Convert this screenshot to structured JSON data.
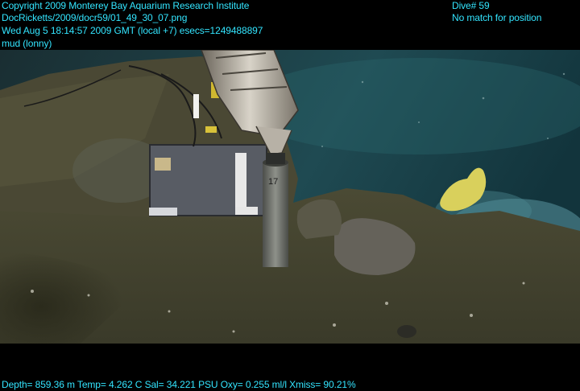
{
  "header": {
    "copyright": "Copyright 2009 Monterey Bay Aquarium Research Institute",
    "filename": "DocRicketts/2009/docr59/01_49_30_07.png",
    "timestamp": "Wed Aug  5 18:14:57 2009 GMT (local +7)  esecs=1249488897",
    "annotation": "mud (lonny)",
    "dive": "Dive# 59",
    "position_status": "No match for position"
  },
  "footer": {
    "telemetry": "Depth= 859.36 m  Temp= 4.262 C  Sal= 34.221 PSU  Oxy= 0.255 ml/l  Xmiss= 90.21%"
  },
  "scene": {
    "core_tube_label": "17"
  },
  "colors": {
    "overlay_text": "#33e5ff",
    "background": "#000000"
  }
}
